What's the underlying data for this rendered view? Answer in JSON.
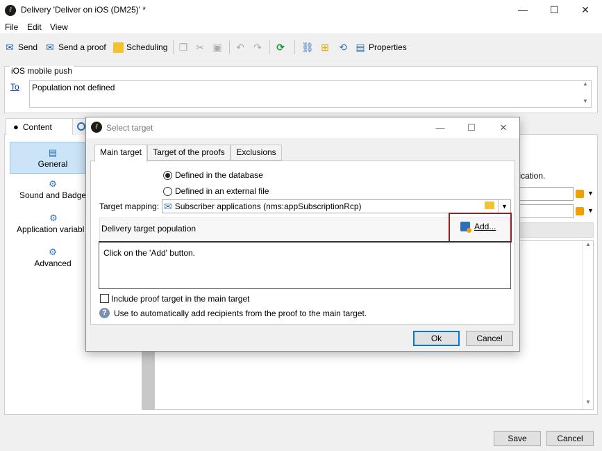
{
  "window": {
    "title": "Delivery 'Deliver on iOS (DM25)' *",
    "app_icon_glyph": "ℓ",
    "minimize_glyph": "—",
    "maximize_glyph": "☐",
    "close_glyph": "✕"
  },
  "menu": {
    "file": "File",
    "edit": "Edit",
    "view": "View"
  },
  "toolbar": {
    "send": "Send",
    "send_proof": "Send a proof",
    "scheduling": "Scheduling",
    "properties": "Properties"
  },
  "target_group": {
    "label": "iOS mobile push",
    "to_link": "To",
    "to_value": "Population not defined"
  },
  "tabs": {
    "content": "Content"
  },
  "sidebar": {
    "items": [
      {
        "label": "General",
        "selected": true
      },
      {
        "label": "Sound and Badge"
      },
      {
        "label": "Application variabl"
      },
      {
        "label": "Advanced"
      }
    ]
  },
  "background": {
    "partial_text": "fication."
  },
  "footer": {
    "save": "Save",
    "cancel": "Cancel"
  },
  "dialog": {
    "title": "Select target",
    "tabs": [
      "Main target",
      "Target of the proofs",
      "Exclusions"
    ],
    "radio_database": "Defined in the database",
    "radio_external": "Defined in an external file",
    "mapping_label": "Target mapping:",
    "mapping_value": "Subscriber applications (nms:appSubscriptionRcp)",
    "population_label": "Delivery target population",
    "add_button": "Add...",
    "population_hint": "Click on the 'Add' button.",
    "include_proof": "Include proof target in the main target",
    "help_text": "Use to automatically add recipients from the proof to the main target.",
    "ok": "Ok",
    "cancel": "Cancel"
  },
  "colors": {
    "selection_bg": "#cce4f7",
    "highlight_border": "#b4121a",
    "link": "#0033cc"
  }
}
